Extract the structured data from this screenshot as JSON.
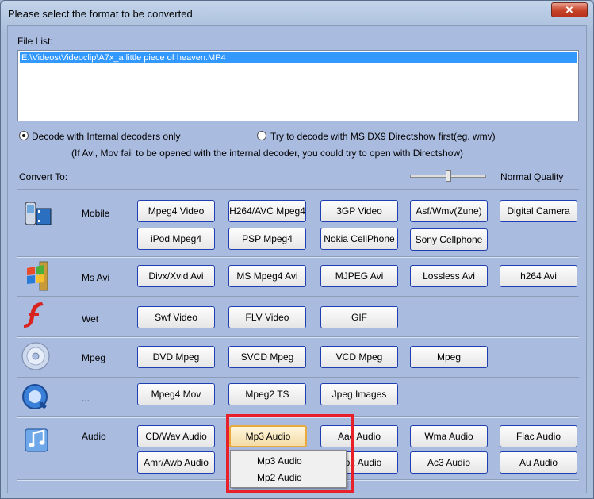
{
  "window": {
    "title": "Please select the format to be converted",
    "close_glyph": "✕"
  },
  "file_list": {
    "label": "File List:",
    "items": [
      "E:\\Videos\\Videoclip\\A7x_a little piece of heaven.MP4"
    ]
  },
  "decode": {
    "internal_label": "Decode with Internal decoders only",
    "internal_selected": true,
    "directshow_label": "Try to decode with MS DX9 Directshow first(eg. wmv)",
    "directshow_selected": false,
    "note": "(If Avi, Mov fail to be opened with the internal decoder, you could try to open with Directshow)"
  },
  "convert_to": {
    "label": "Convert To:",
    "quality_label": "Normal Quality",
    "quality_level": 0.5
  },
  "categories": [
    {
      "name": "Mobile",
      "icon": "mobile-phone-icon",
      "buttons": [
        "Mpeg4 Video",
        "H264/AVC Mpeg4",
        "3GP Video",
        "Asf/Wmv(Zune)",
        "Digital Camera",
        "iPod Mpeg4",
        "PSP Mpeg4",
        "Nokia CellPhone",
        "Sony Cellphone"
      ]
    },
    {
      "name": "Ms Avi",
      "icon": "windows-film-icon",
      "buttons": [
        "Divx/Xvid Avi",
        "MS Mpeg4 Avi",
        "MJPEG Avi",
        "Lossless Avi",
        "h264 Avi"
      ]
    },
    {
      "name": "Wet",
      "icon": "flash-icon",
      "buttons": [
        "Swf Video",
        "FLV Video",
        "GIF"
      ]
    },
    {
      "name": "Mpeg",
      "icon": "disc-icon",
      "buttons": [
        "DVD Mpeg",
        "SVCD Mpeg",
        "VCD Mpeg",
        "Mpeg"
      ]
    },
    {
      "name": "...",
      "icon": "quicktime-icon",
      "buttons": [
        "Mpeg4 Mov",
        "Mpeg2 TS",
        "Jpeg Images"
      ]
    },
    {
      "name": "Audio",
      "icon": "music-note-icon",
      "buttons": [
        "CD/Wav Audio",
        "Mp3 Audio",
        "Aac Audio",
        "Wma Audio",
        "Flac Audio",
        "Amr/Awb Audio",
        "Mp2 Audio",
        "Ac3 Audio",
        "Au  Audio"
      ]
    }
  ],
  "popup_menu": {
    "items": [
      "Mp3 Audio",
      "Mp2 Audio"
    ]
  },
  "colors": {
    "client_bg": "#aabbe0",
    "button_border": "#1f3fb0",
    "highlight": "#e8202a",
    "selection": "#3399ff"
  }
}
